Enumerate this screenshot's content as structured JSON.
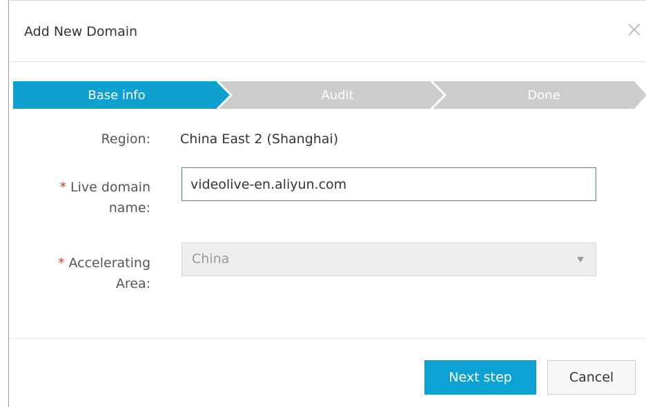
{
  "dialog": {
    "title": "Add New Domain"
  },
  "steps": [
    {
      "label": "Base info",
      "active": true
    },
    {
      "label": "Audit",
      "active": false
    },
    {
      "label": "Done",
      "active": false
    }
  ],
  "form": {
    "region": {
      "label": "Region:",
      "value": "China East 2 (Shanghai)"
    },
    "domain": {
      "required_mark": "*",
      "label_line1": "Live domain",
      "label_line2": "name:",
      "value": "videolive-en.aliyun.com"
    },
    "area": {
      "required_mark": "*",
      "label_line1": "Accelerating",
      "label_line2": "Area:",
      "value": "China",
      "disabled": true
    }
  },
  "footer": {
    "next_label": "Next step",
    "cancel_label": "Cancel"
  },
  "colors": {
    "step_active": "#0ea1cf",
    "step_inactive": "#cccccc",
    "primary": "#0da2d3",
    "required": "#e4393c",
    "input_focus_border": "#2ea33a"
  }
}
